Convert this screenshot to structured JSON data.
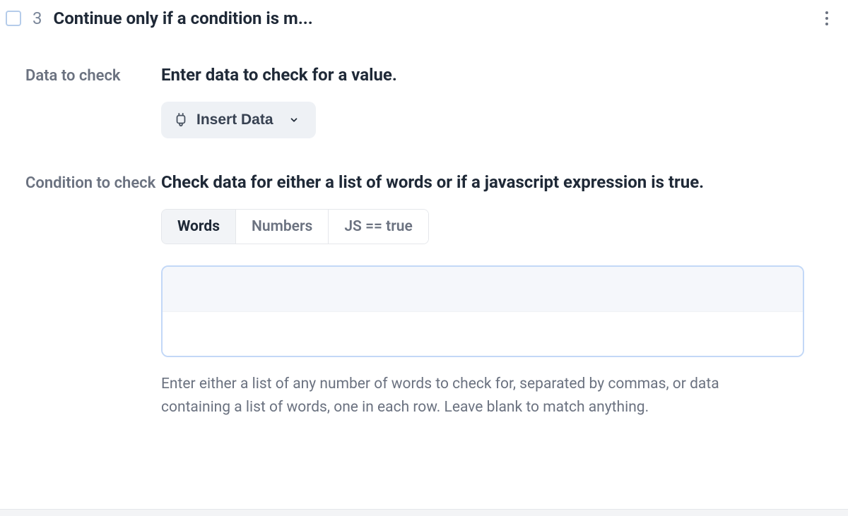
{
  "header": {
    "step_number": "3",
    "title": "Continue only if a condition is m..."
  },
  "fields": {
    "data_to_check": {
      "label": "Data to check",
      "heading": "Enter data to check for a value.",
      "insert_button": {
        "label": "Insert Data"
      }
    },
    "condition_to_check": {
      "label": "Condition to check",
      "heading": "Check data for either a list of words or if a javascript expression is true.",
      "tabs": {
        "words": "Words",
        "numbers": "Numbers",
        "js": "JS == true",
        "active": "words"
      },
      "input_value": "",
      "help_text": "Enter either a list of any number of words to check for, separated by commas, or data containing a list of words, one in each row. Leave blank to match anything."
    }
  }
}
